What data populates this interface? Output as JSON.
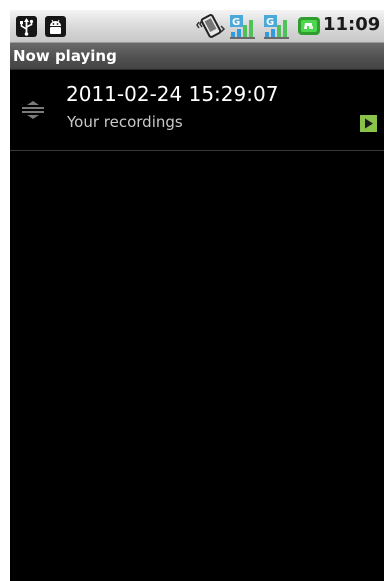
{
  "status_bar": {
    "time": "11:09 AM",
    "icons": [
      "usb-icon",
      "android-debug-icon",
      "vibrate-icon",
      "signal-icon",
      "signal-icon",
      "battery-charging-icon"
    ],
    "network_type": "G"
  },
  "header": {
    "title": "Now playing"
  },
  "list": {
    "items": [
      {
        "title": "2011-02-24 15:29:07",
        "subtitle": "Your recordings",
        "icon": "drag-handle-icon",
        "status_icon": "play-icon"
      }
    ]
  },
  "colors": {
    "background": "#000000",
    "play_accent": "#8bc34a"
  }
}
